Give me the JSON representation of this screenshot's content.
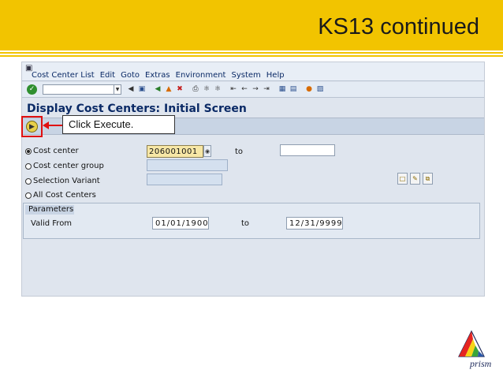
{
  "slide": {
    "title": "KS13 continued",
    "banner_color": "#f2c400"
  },
  "menubar": {
    "items": [
      "Cost Center List",
      "Edit",
      "Goto",
      "Extras",
      "Environment",
      "System",
      "Help"
    ]
  },
  "toolbar": {
    "icons": [
      "enter-icon",
      "back-icon",
      "exit-icon",
      "cancel-icon",
      "print-icon",
      "find-icon",
      "find-next-icon",
      "first-page-icon",
      "previous-page-icon",
      "next-page-icon",
      "last-page-icon",
      "create-session-icon",
      "shortcut-icon",
      "help-icon",
      "layout-icon"
    ]
  },
  "screen": {
    "title": "Display Cost Centers: Initial Screen"
  },
  "callout": {
    "text": "Click Execute.",
    "highlight_color": "#e01010"
  },
  "selection": {
    "options": [
      {
        "label": "Cost center",
        "selected": true
      },
      {
        "label": "Cost center group",
        "selected": false
      },
      {
        "label": "Selection Variant",
        "selected": false
      },
      {
        "label": "All Cost Centers",
        "selected": false
      }
    ],
    "cost_center_value": "206001001",
    "to_label": "to"
  },
  "parameters": {
    "header": "Parameters",
    "valid_from_label": "Valid From",
    "valid_from": "01/01/1900",
    "to_label": "to",
    "valid_to": "12/31/9999"
  },
  "logo": {
    "text": "prism"
  }
}
